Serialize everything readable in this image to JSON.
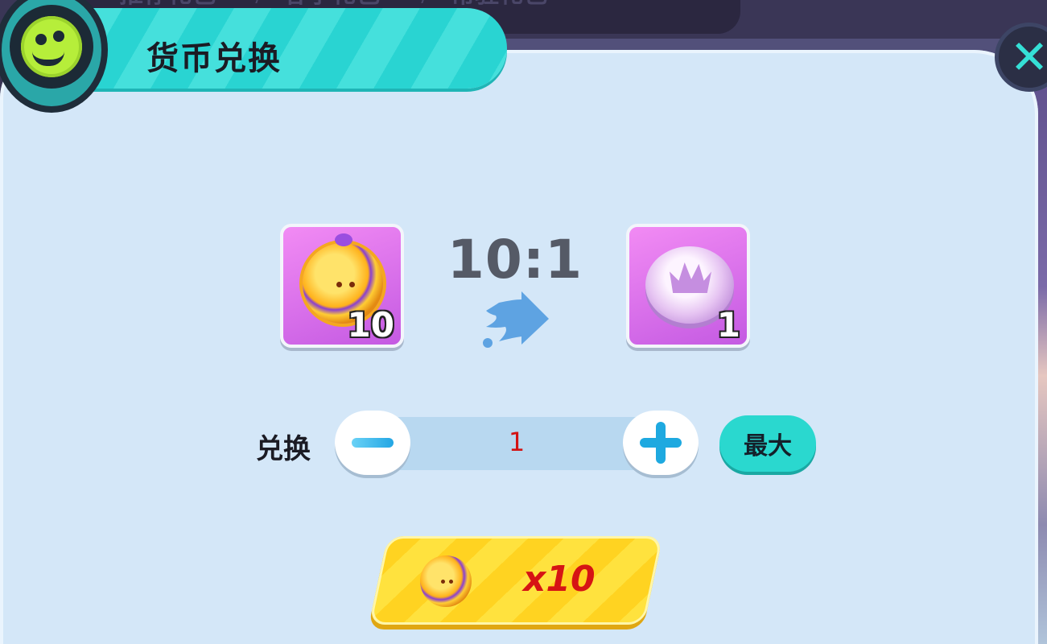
{
  "background": {
    "tabs": [
      "推荐礼包",
      "春季礼包",
      "常驻礼包"
    ]
  },
  "dialog": {
    "title": "货币兑换",
    "close_label": "✕"
  },
  "exchange": {
    "from": {
      "icon": "gold-coin-icon",
      "count": "10"
    },
    "ratio": "10:1",
    "to": {
      "icon": "crown-coin-icon",
      "count": "1"
    }
  },
  "quantity": {
    "label": "兑换",
    "value": "1",
    "max_label": "最大"
  },
  "confirm": {
    "cost": "x10",
    "icon": "gold-coin-icon"
  },
  "colors": {
    "panel": "#d4e7f8",
    "header": "#29d4d2",
    "card": "#d46be9",
    "confirm": "#ffd321",
    "quantity_text": "#d31313"
  }
}
